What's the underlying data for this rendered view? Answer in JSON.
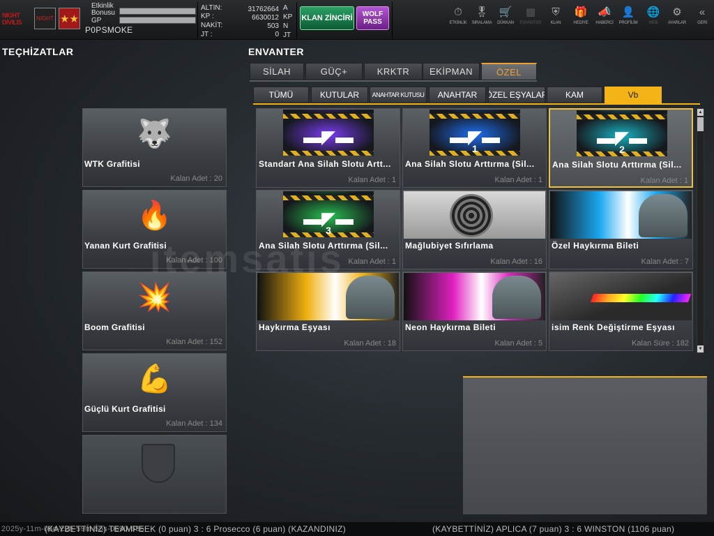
{
  "topbar": {
    "logo_text": "NIGHT DIVILIS",
    "clan_emblem_text": "NIGHT",
    "rank_emblem_text": "★★",
    "event_bonus_label": "Etkinlik Bonusu",
    "gp_label": "GP",
    "player_name": "P0PSMOKE",
    "currencies": [
      {
        "label": "ALTIN:",
        "value": "31762664",
        "unit": "A"
      },
      {
        "label": "KP :",
        "value": "6630012",
        "unit": "KP"
      },
      {
        "label": "NAKİT:",
        "value": "503",
        "unit": "N"
      },
      {
        "label": "JT :",
        "value": "0",
        "unit": "JT"
      }
    ],
    "clan_chain_button": "KLAN ZİNCİRİ",
    "wolf_pass_button": "WOLF PASS",
    "nav": [
      {
        "label": "ETKİNLİK",
        "icon": "stopwatch-icon",
        "glyph": "⏱"
      },
      {
        "label": "SIRALAMA",
        "icon": "medal-icon",
        "glyph": "🎖"
      },
      {
        "label": "DÜKKAN",
        "icon": "cart-icon",
        "glyph": "🛒"
      },
      {
        "label": "ENVANTER",
        "icon": "inventory-icon",
        "glyph": "▦"
      },
      {
        "label": "KLAN",
        "icon": "shield-icon",
        "glyph": "⛨"
      },
      {
        "label": "HEDİYE",
        "icon": "gift-icon",
        "glyph": "🎁"
      },
      {
        "label": "HABERCİ",
        "icon": "megaphone-icon",
        "glyph": "📣"
      },
      {
        "label": "PROFİLİM",
        "icon": "profile-icon",
        "glyph": "👤"
      },
      {
        "label": "WEB",
        "icon": "globe-icon",
        "glyph": "🌐"
      },
      {
        "label": "AYARLAR",
        "icon": "gear-icon",
        "glyph": "⚙"
      },
      {
        "label": "GERİ",
        "icon": "back-icon",
        "glyph": "«"
      }
    ]
  },
  "left": {
    "title": "TEÇHİZATLAR",
    "items": [
      {
        "name": "WTK Grafitisi",
        "count": "Kalan Adet : 20",
        "icon": "wolf-head-icon",
        "glyph": "🐺"
      },
      {
        "name": "Yanan Kurt Grafitisi",
        "count": "Kalan Adet : 100",
        "icon": "flaming-wolf-icon",
        "glyph": "🔥"
      },
      {
        "name": "Boom Grafitisi",
        "count": "Kalan Adet : 152",
        "icon": "boom-grenade-icon",
        "glyph": "💥"
      },
      {
        "name": "Güçlü Kurt Grafitisi",
        "count": "Kalan Adet : 134",
        "icon": "strong-wolf-icon",
        "glyph": "💪"
      }
    ]
  },
  "inventory": {
    "title": "ENVANTER",
    "tabs": [
      "SİLAH",
      "GÜÇ+",
      "KRKTR",
      "EKİPMAN",
      "ÖZEL"
    ],
    "active_tab": "ÖZEL",
    "subtabs": [
      "TÜMÜ",
      "KUTULAR",
      "ANAHTAR KUTUSU",
      "ANAHTAR",
      "ÖZEL EŞYALAR",
      "KAM",
      "Vb"
    ],
    "active_subtab": "Vb",
    "items": [
      {
        "name": "Standart Ana Silah Slotu Artt...",
        "count": "Kalan Adet : 1",
        "icon": "rifle-slot-icon",
        "number": "",
        "theme": "purple"
      },
      {
        "name": "Ana Silah Slotu Arttırma (Sil...",
        "count": "Kalan Adet : 1",
        "icon": "rifle-slot-icon",
        "number": "1",
        "theme": "blue"
      },
      {
        "name": "Ana Silah Slotu Arttırma (Sil...",
        "count": "Kalan Adet : 1",
        "icon": "rifle-slot-icon",
        "number": "2",
        "theme": "teal"
      },
      {
        "name": "Ana Silah Slotu Arttırma (Sil...",
        "count": "Kalan Adet : 1",
        "icon": "rifle-slot-icon",
        "number": "3",
        "theme": "green"
      },
      {
        "name": "Mağlubiyet  Sıfırlama",
        "count": "Kalan Adet : 16",
        "icon": "target-reset-icon",
        "number": "",
        "theme": "gray"
      },
      {
        "name": "Özel Haykırma Bileti",
        "count": "Kalan Adet : 7",
        "icon": "soldier-shout-icon",
        "number": "",
        "theme": "cyan"
      },
      {
        "name": "Haykırma Eşyası",
        "count": "Kalan Adet : 18",
        "icon": "soldier-shout-icon",
        "number": "",
        "theme": "yellow"
      },
      {
        "name": "Neon Haykırma Bileti",
        "count": "Kalan Adet : 5",
        "icon": "soldier-shout-icon",
        "number": "",
        "theme": "pink"
      },
      {
        "name": "isim Renk Değiştirme Eşyası",
        "count": "Kalan Süre : 182",
        "icon": "callsign-color-icon",
        "number": "",
        "theme": "dark"
      }
    ],
    "selected_index": 2
  },
  "ticker": {
    "timestamp": "2025y-11m-06d-22h-59m-55s-0690-685",
    "message1": "(KAYBETTİNİZ) TEAMPEEK (0 puan) 3 : 6 Prosecco (6 puan) (KAZANDINIZ)",
    "message2": "(KAYBETTİNİZ) APLICA (7 puan) 3 : 6 WINSTON (1106 puan)"
  },
  "watermark": "itemsatis",
  "colors": {
    "accent": "#f4b418",
    "active_tab": "#f0a030",
    "clan_btn": "#1a7a48",
    "wolf_btn": "#9a3ab8"
  }
}
